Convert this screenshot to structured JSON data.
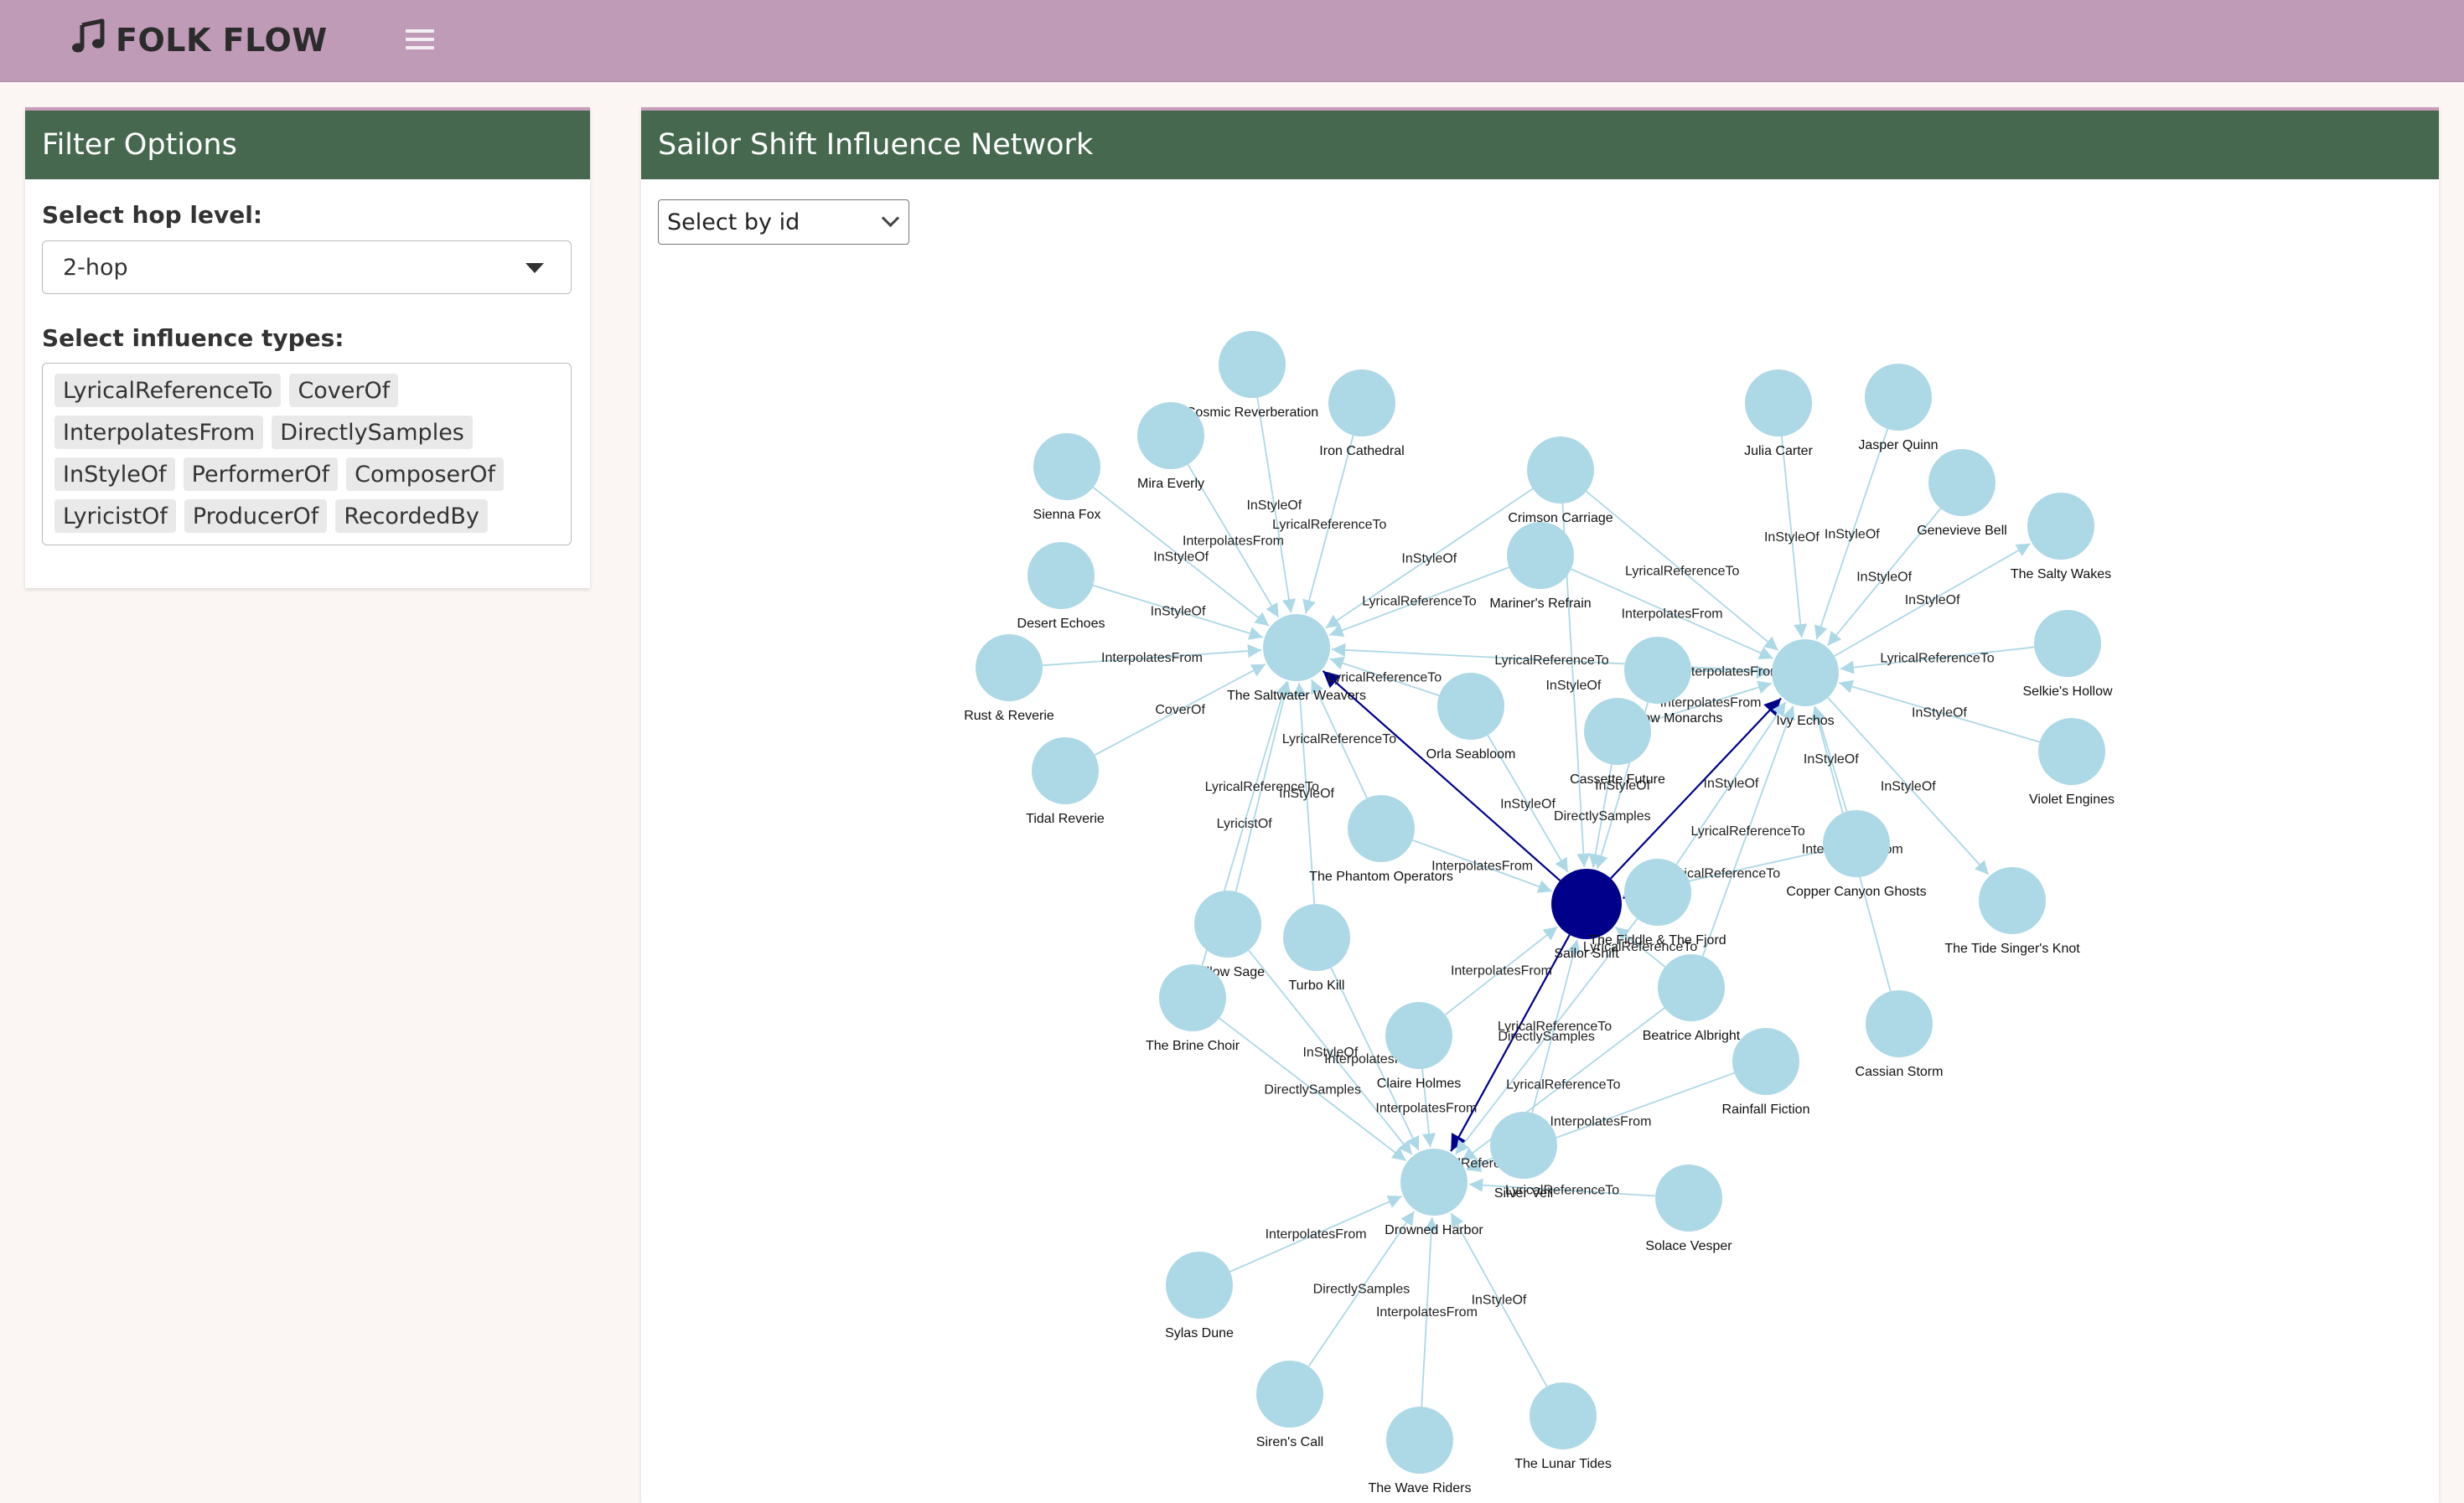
{
  "app": {
    "title": "FOLK FLOW"
  },
  "icons": {
    "brand": "music-note-icon",
    "menu": "hamburger-menu-icon",
    "select": "chevron-down-icon"
  },
  "colors": {
    "topbar": "#bf9bb7",
    "box_header": "#46684f",
    "node": "#add8e6",
    "focus_node": "#00008b",
    "edge": "#add8e6",
    "focus_edge": "#00008b"
  },
  "sidebar": {
    "title": "Filter Options",
    "hop_label": "Select hop level:",
    "hop_value": "2-hop",
    "types_label": "Select influence types:",
    "types": [
      "LyricalReferenceTo",
      "CoverOf",
      "InterpolatesFrom",
      "DirectlySamples",
      "InStyleOf",
      "PerformerOf",
      "ComposerOf",
      "LyricistOf",
      "ProducerOf",
      "RecordedBy"
    ]
  },
  "main": {
    "title": "Sailor Shift Influence Network",
    "id_select": "Select by id"
  },
  "network": {
    "focus": "Sailor Shift",
    "nodes": [
      "Sailor Shift",
      "The Saltwater Weavers",
      "Ivy Echos",
      "Drowned Harbor",
      "Cosmic Reverberation",
      "Iron Cathedral",
      "Mira Everly",
      "Sienna Fox",
      "Desert Echoes",
      "Rust & Reverie",
      "Tidal Reverie",
      "Crimson Carriage",
      "Mariner's Refrain",
      "Orla Seabloom",
      "The Hollow Monarchs",
      "Cassette Future",
      "The Phantom Operators",
      "Willow Sage",
      "Turbo Kill",
      "The Brine Choir",
      "The Fiddle & The Fjord",
      "Julia Carter",
      "Jasper Quinn",
      "Genevieve Bell",
      "The Salty Wakes",
      "Selkie's Hollow",
      "Violet Engines",
      "Copper Canyon Ghosts",
      "The Tide Singer's Knot",
      "Cassian Storm",
      "Beatrice Albright",
      "Rainfall Fiction",
      "Claire Holmes",
      "Silver Veil",
      "Solace Vesper",
      "Sylas Dune",
      "Siren's Call",
      "The Wave Riders",
      "The Lunar Tides"
    ],
    "edges": [
      {
        "from": "Sailor Shift",
        "to": "The Saltwater Weavers",
        "label": "",
        "focus": true
      },
      {
        "from": "Sailor Shift",
        "to": "Ivy Echos",
        "label": "",
        "focus": true
      },
      {
        "from": "Sailor Shift",
        "to": "Drowned Harbor",
        "label": "",
        "focus": true
      },
      {
        "from": "The Fiddle & The Fjord",
        "to": "Sailor Shift",
        "label": "",
        "focus": true
      },
      {
        "from": "Cosmic Reverberation",
        "to": "The Saltwater Weavers",
        "label": "InStyleOf"
      },
      {
        "from": "Iron Cathedral",
        "to": "The Saltwater Weavers",
        "label": "LyricalReferenceTo"
      },
      {
        "from": "Mira Everly",
        "to": "The Saltwater Weavers",
        "label": "InterpolatesFrom"
      },
      {
        "from": "Sienna Fox",
        "to": "The Saltwater Weavers",
        "label": "InStyleOf"
      },
      {
        "from": "Desert Echoes",
        "to": "The Saltwater Weavers",
        "label": "InStyleOf"
      },
      {
        "from": "Rust & Reverie",
        "to": "The Saltwater Weavers",
        "label": "InterpolatesFrom"
      },
      {
        "from": "Tidal Reverie",
        "to": "The Saltwater Weavers",
        "label": "CoverOf"
      },
      {
        "from": "Crimson Carriage",
        "to": "The Saltwater Weavers",
        "label": "InStyleOf"
      },
      {
        "from": "Mariner's Refrain",
        "to": "The Saltwater Weavers",
        "label": "LyricalReferenceTo"
      },
      {
        "from": "Ivy Echos",
        "to": "The Saltwater Weavers",
        "label": "LyricalReferenceTo"
      },
      {
        "from": "Orla Seabloom",
        "to": "The Saltwater Weavers",
        "label": "LyricalReferenceTo"
      },
      {
        "from": "Willow Sage",
        "to": "The Saltwater Weavers",
        "label": "LyricalReferenceTo"
      },
      {
        "from": "The Brine Choir",
        "to": "The Saltwater Weavers",
        "label": "LyricistOf"
      },
      {
        "from": "Turbo Kill",
        "to": "The Saltwater Weavers",
        "label": "InStyleOf"
      },
      {
        "from": "The Phantom Operators",
        "to": "The Saltwater Weavers",
        "label": "LyricalReferenceTo"
      },
      {
        "from": "Crimson Carriage",
        "to": "Ivy Echos",
        "label": "LyricalReferenceTo"
      },
      {
        "from": "Mariner's Refrain",
        "to": "Ivy Echos",
        "label": "InterpolatesFrom"
      },
      {
        "from": "Julia Carter",
        "to": "Ivy Echos",
        "label": "InStyleOf"
      },
      {
        "from": "Jasper Quinn",
        "to": "Ivy Echos",
        "label": "InStyleOf"
      },
      {
        "from": "Genevieve Bell",
        "to": "Ivy Echos",
        "label": "InStyleOf"
      },
      {
        "from": "Ivy Echos",
        "to": "The Salty Wakes",
        "label": "InStyleOf"
      },
      {
        "from": "Selkie's Hollow",
        "to": "Ivy Echos",
        "label": "LyricalReferenceTo"
      },
      {
        "from": "Violet Engines",
        "to": "Ivy Echos",
        "label": "InStyleOf"
      },
      {
        "from": "Ivy Echos",
        "to": "The Tide Singer's Knot",
        "label": "InStyleOf"
      },
      {
        "from": "The Hollow Monarchs",
        "to": "Ivy Echos",
        "label": "InterpolatesFrom"
      },
      {
        "from": "Copper Canyon Ghosts",
        "to": "Ivy Echos",
        "label": "InStyleOf"
      },
      {
        "from": "Cassette Future",
        "to": "Ivy Echos",
        "label": "InterpolatesFrom"
      },
      {
        "from": "The Fiddle & The Fjord",
        "to": "Ivy Echos",
        "label": "InStyleOf"
      },
      {
        "from": "Beatrice Albright",
        "to": "Ivy Echos",
        "label": "LyricalReferenceTo"
      },
      {
        "from": "Cassian Storm",
        "to": "Ivy Echos",
        "label": "InterpolatesFrom"
      },
      {
        "from": "Copper Canyon Ghosts",
        "to": "Sailor Shift",
        "label": "LyricalReferenceTo"
      },
      {
        "from": "Crimson Carriage",
        "to": "Sailor Shift",
        "label": "InStyleOf"
      },
      {
        "from": "Orla Seabloom",
        "to": "Sailor Shift",
        "label": "InStyleOf"
      },
      {
        "from": "The Hollow Monarchs",
        "to": "Sailor Shift",
        "label": "InStyleOf"
      },
      {
        "from": "Cassette Future",
        "to": "Sailor Shift",
        "label": "DirectlySamples"
      },
      {
        "from": "The Phantom Operators",
        "to": "Sailor Shift",
        "label": "InterpolatesFrom"
      },
      {
        "from": "Claire Holmes",
        "to": "Sailor Shift",
        "label": "InterpolatesFrom"
      },
      {
        "from": "Beatrice Albright",
        "to": "Sailor Shift",
        "label": "LyricalReferenceTo"
      },
      {
        "from": "Silver Veil",
        "to": "Sailor Shift",
        "label": "LyricalReferenceTo"
      },
      {
        "from": "Willow Sage",
        "to": "Drowned Harbor",
        "label": "InStyleOf"
      },
      {
        "from": "The Brine Choir",
        "to": "Drowned Harbor",
        "label": "DirectlySamples"
      },
      {
        "from": "Turbo Kill",
        "to": "Drowned Harbor",
        "label": "InterpolatesFrom"
      },
      {
        "from": "Claire Holmes",
        "to": "Drowned Harbor",
        "label": "InterpolatesFrom"
      },
      {
        "from": "Silver Veil",
        "to": "Drowned Harbor",
        "label": "LyricalReferenceTo"
      },
      {
        "from": "Beatrice Albright",
        "to": "Drowned Harbor",
        "label": "LyricalReferenceTo"
      },
      {
        "from": "Rainfall Fiction",
        "to": "Drowned Harbor",
        "label": "InterpolatesFrom"
      },
      {
        "from": "Solace Vesper",
        "to": "Drowned Harbor",
        "label": "LyricalReferenceTo"
      },
      {
        "from": "Sylas Dune",
        "to": "Drowned Harbor",
        "label": "InterpolatesFrom"
      },
      {
        "from": "Siren's Call",
        "to": "Drowned Harbor",
        "label": "DirectlySamples"
      },
      {
        "from": "The Wave Riders",
        "to": "Drowned Harbor",
        "label": "InterpolatesFrom"
      },
      {
        "from": "The Lunar Tides",
        "to": "Drowned Harbor",
        "label": "InStyleOf"
      },
      {
        "from": "The Fiddle & The Fjord",
        "to": "Drowned Harbor",
        "label": "DirectlySamples"
      }
    ]
  }
}
